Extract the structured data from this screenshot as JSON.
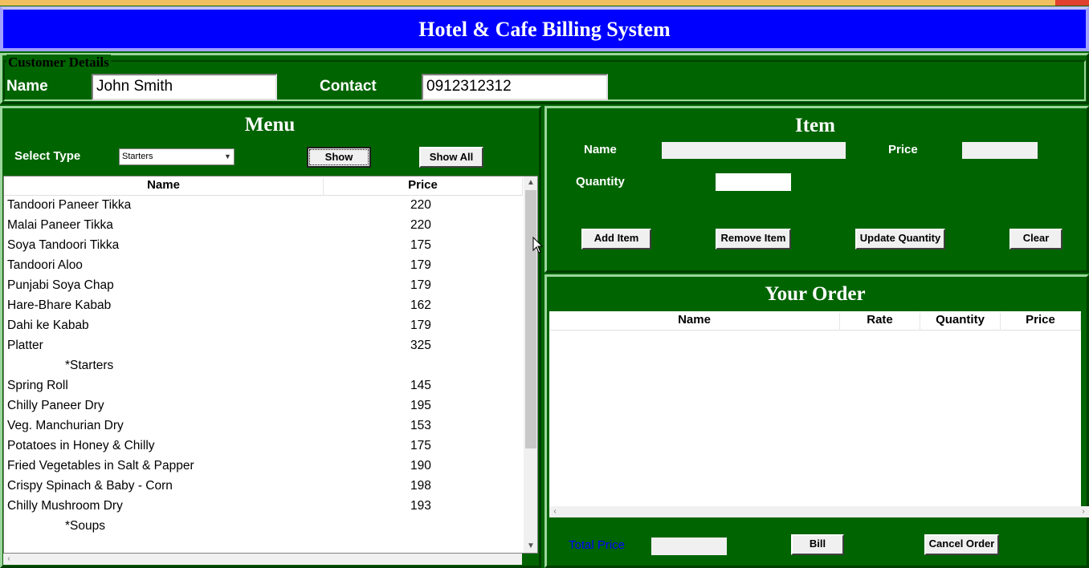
{
  "app": {
    "title": "Hotel & Cafe Billing System"
  },
  "customer": {
    "legend": "Customer Details",
    "name_label": "Name",
    "name_value": "John Smith",
    "contact_label": "Contact",
    "contact_value": "0912312312"
  },
  "menu": {
    "title": "Menu",
    "select_label": "Select Type",
    "select_value": "Starters",
    "show_button": "Show",
    "show_all_button": "Show All",
    "columns": [
      "Name",
      "Price"
    ],
    "rows": [
      {
        "name": "Tandoori Paneer Tikka",
        "price": "220"
      },
      {
        "name": "Malai Paneer Tikka",
        "price": "220"
      },
      {
        "name": "Soya Tandoori Tikka",
        "price": "175"
      },
      {
        "name": "Tandoori Aloo",
        "price": "179"
      },
      {
        "name": "Punjabi Soya Chap",
        "price": "179"
      },
      {
        "name": "Hare-Bhare Kabab",
        "price": "162"
      },
      {
        "name": "Dahi ke Kabab",
        "price": "179"
      },
      {
        "name": "Platter",
        "price": "325"
      },
      {
        "name": "*Starters",
        "price": "",
        "group": true
      },
      {
        "name": "Spring Roll",
        "price": "145"
      },
      {
        "name": "Chilly Paneer Dry",
        "price": "195"
      },
      {
        "name": "Veg. Manchurian Dry",
        "price": "153"
      },
      {
        "name": "Potatoes in Honey & Chilly",
        "price": "175"
      },
      {
        "name": "Fried Vegetables in Salt & Papper",
        "price": "190"
      },
      {
        "name": "Crispy Spinach & Baby - Corn",
        "price": "198"
      },
      {
        "name": "Chilly Mushroom Dry",
        "price": "193"
      },
      {
        "name": "*Soups",
        "price": "",
        "group": true
      }
    ]
  },
  "item": {
    "title": "Item",
    "name_label": "Name",
    "price_label": "Price",
    "quantity_label": "Quantity",
    "add_button": "Add Item",
    "remove_button": "Remove Item",
    "update_button": "Update Quantity",
    "clear_button": "Clear"
  },
  "order": {
    "title": "Your Order",
    "columns": [
      "Name",
      "Rate",
      "Quantity",
      "Price"
    ],
    "total_label": "Total Price",
    "bill_button": "Bill",
    "cancel_button": "Cancel Order"
  },
  "icons": {
    "dropdown": "chevron-down-icon",
    "scroll_up": "arrow-up-icon",
    "scroll_down": "arrow-down-icon"
  }
}
